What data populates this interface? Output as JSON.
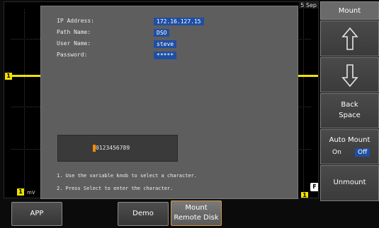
{
  "scope": {
    "date_tag": "5 Sep",
    "channel_marker": "1",
    "bottom_marker": "1",
    "bottom_scale": "mV",
    "right_marker": "F",
    "right_bottom_marker": "1",
    "trace_color": "#f2e100"
  },
  "dialog": {
    "fields": [
      {
        "label": "IP Address:",
        "value": "172.16.127.15"
      },
      {
        "label": "Path Name:",
        "value": "DSO"
      },
      {
        "label": "User Name:",
        "value": "steve"
      },
      {
        "label": "Password:",
        "value": "*****"
      }
    ],
    "charset": "0123456789",
    "instructions": [
      "1. Use the variable knob to select a character.",
      "2. Press Select to enter the character."
    ]
  },
  "softkeys": {
    "title": "Mount",
    "up_icon": "up-arrow-icon",
    "down_icon": "down-arrow-icon",
    "backspace_line1": "Back",
    "backspace_line2": "Space",
    "auto_mount_label": "Auto Mount",
    "auto_mount_on": "On",
    "auto_mount_off": "Off",
    "auto_mount_selected": "Off",
    "unmount": "Unmount"
  },
  "bottom_buttons": {
    "app": "APP",
    "demo": "Demo",
    "mount_line1": "Mount",
    "mount_line2": "Remote Disk"
  },
  "colors": {
    "selected_blue": "#1f4fa3",
    "cursor_orange": "#ff8a00"
  }
}
